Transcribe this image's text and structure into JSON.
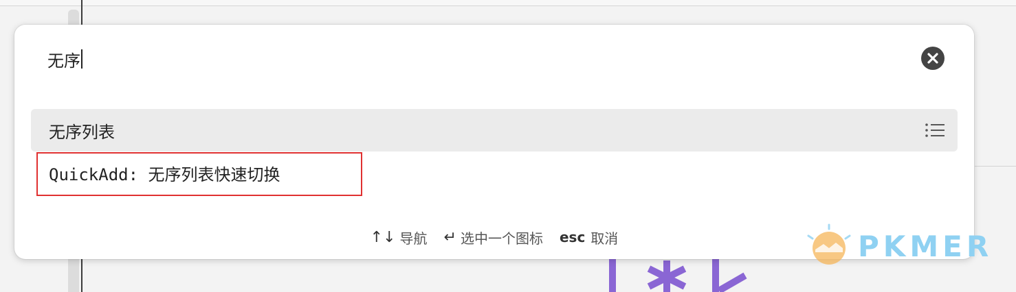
{
  "search": {
    "value": "无序"
  },
  "results": [
    {
      "label": "无序列表",
      "icon": "list-icon",
      "selected": true
    },
    {
      "label": "QuickAdd: 无序列表快速切换",
      "icon": "",
      "selected": false
    }
  ],
  "footer": {
    "navigate_keys": "↑↓",
    "navigate_label": "导航",
    "select_key": "↵",
    "select_label": "选中一个图标",
    "cancel_key": "esc",
    "cancel_label": "取消"
  },
  "watermark": {
    "text": "PKMER"
  },
  "colors": {
    "highlight_border": "#e03030",
    "selected_row": "#ebebeb",
    "watermark_blue": "#8fd1f2",
    "watermark_orange": "#f5b55a",
    "background_glyph": "#8a66d4"
  }
}
